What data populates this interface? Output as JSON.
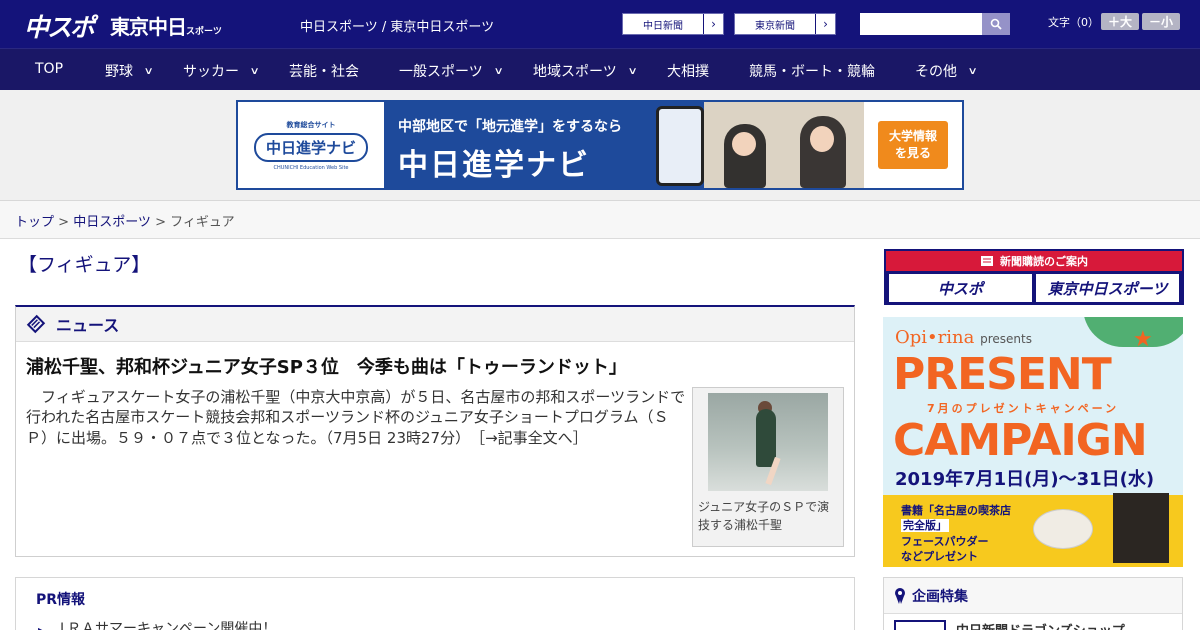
{
  "header": {
    "logo_chusupo": "中スポ",
    "logo_tokyo": "東京中日",
    "logo_tokyo_small": "スポーツ",
    "site_title": "中日スポーツ / 東京中日スポーツ",
    "paper_links": [
      "中日新聞",
      "東京新聞"
    ],
    "search_placeholder": "",
    "font_size_label": "文字（0）",
    "font_bigger": "＋大",
    "font_smaller": "－小",
    "colors": {
      "bar": "#14137a",
      "nav": "#1a1766"
    }
  },
  "nav": {
    "items": [
      {
        "label": "TOP",
        "dropdown": false
      },
      {
        "label": "野球",
        "dropdown": true
      },
      {
        "label": "サッカー",
        "dropdown": true
      },
      {
        "label": "芸能・社会",
        "dropdown": false
      },
      {
        "label": "一般スポーツ",
        "dropdown": true
      },
      {
        "label": "地域スポーツ",
        "dropdown": true
      },
      {
        "label": "大相撲",
        "dropdown": false
      },
      {
        "label": "競馬・ボート・競輪",
        "dropdown": false
      },
      {
        "label": "その他",
        "dropdown": true
      }
    ],
    "chevron": "∨"
  },
  "banner": {
    "logo_small": "教育総合サイト",
    "logo_main": "中日進学ナビ",
    "logo_eng": "CHUNICHI Education Web Site",
    "line1": "中部地区で「地元進学」をするなら",
    "line2": "中日進学ナビ",
    "cta_line1": "大学情報",
    "cta_line2": "を見る"
  },
  "breadcrumb": {
    "top": "トップ",
    "sep": " > ",
    "section": "中日スポーツ",
    "current": "フィギュア"
  },
  "main": {
    "page_heading": "【フィギュア】",
    "news_label": "ニュース",
    "article": {
      "title": "浦松千聖、邦和杯ジュニア女子SP３位　今季も曲は「トゥーランドット」",
      "body": "フィギュアスケート女子の浦松千聖（中京大中京高）が５日、名古屋市の邦和スポーツランドで行われた名古屋市スケート競技会邦和スポーツランド杯のジュニア女子ショートプログラム（ＳＰ）に出場。５９・０７点で３位となった。（7月5日 23時27分）",
      "more_link": "［→記事全文へ］",
      "photo_caption": "ジュニア女子のＳＰで演技する浦松千聖"
    },
    "pr": {
      "title": "PR情報",
      "items": [
        "ＪＲＡサマーキャンペーン開催中！"
      ]
    }
  },
  "sidebar": {
    "subscribe_head": "新聞購読のご案内",
    "subscribe_btns": [
      "中スポ",
      "東京中日スポーツ"
    ],
    "campaign": {
      "brand": "Opi•rina",
      "brand_suffix": "presents",
      "present": "PRESENT",
      "sub": "7月のプレゼントキャンペーン",
      "camp": "CAMPAIGN",
      "dates": "2019年7月1日(月)～31日(水)",
      "book_line1": "書籍「名古屋の喫茶店",
      "book_line2": "完全版」",
      "book_line3": "フェースパウダー",
      "book_line4": "などプレゼント"
    },
    "kikaku": {
      "title": "企画特集",
      "item": "中日新聞ドラゴンズショップ"
    }
  }
}
